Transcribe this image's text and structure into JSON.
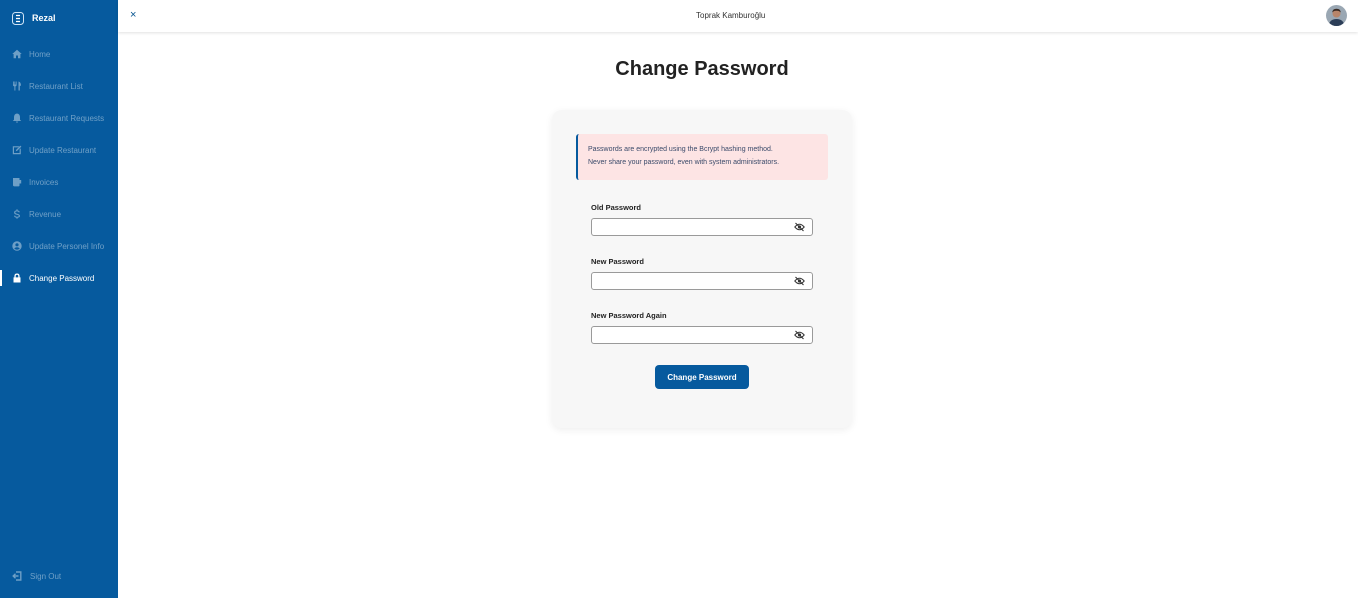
{
  "app": {
    "name": "Rezal"
  },
  "sidebar": {
    "items": [
      {
        "label": "Home",
        "icon": "home-icon",
        "active": false
      },
      {
        "label": "Restaurant List",
        "icon": "utensils-icon",
        "active": false
      },
      {
        "label": "Restaurant Requests",
        "icon": "bell-icon",
        "active": false
      },
      {
        "label": "Update Restaurant",
        "icon": "edit-icon",
        "active": false
      },
      {
        "label": "Invoices",
        "icon": "receipt-icon",
        "active": false
      },
      {
        "label": "Revenue",
        "icon": "dollar-icon",
        "active": false
      },
      {
        "label": "Update Personel Info",
        "icon": "user-circle-icon",
        "active": false
      },
      {
        "label": "Change Password",
        "icon": "lock-icon",
        "active": true
      }
    ],
    "sign_out": "Sign Out"
  },
  "topbar": {
    "close_glyph": "×",
    "user_name": "Toprak Kamburoğlu"
  },
  "main": {
    "title": "Change Password",
    "alert": {
      "line1": "Passwords are encrypted using the Bcrypt hashing method.",
      "line2": "Never share your password, even with system administrators."
    },
    "fields": [
      {
        "label": "Old Password",
        "value": ""
      },
      {
        "label": "New Password",
        "value": ""
      },
      {
        "label": "New Password Again",
        "value": ""
      }
    ],
    "submit_label": "Change Password"
  },
  "colors": {
    "primary": "#065a9e",
    "alert_bg": "#fde4e4",
    "card_bg": "#f7f7f7"
  }
}
